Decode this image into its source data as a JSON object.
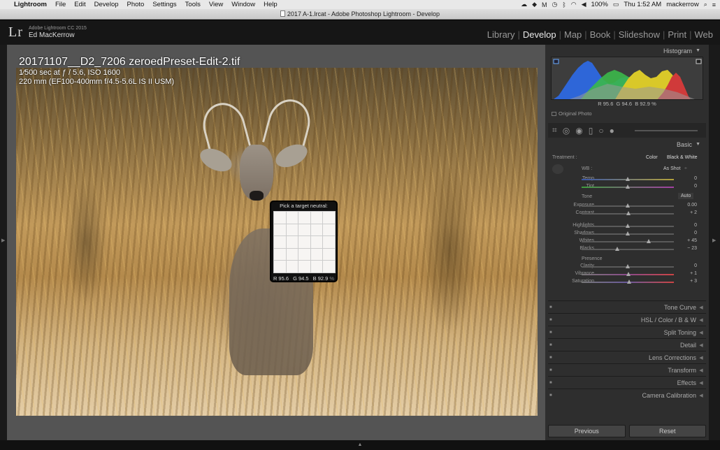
{
  "menubar": {
    "items": [
      "Lightroom",
      "File",
      "Edit",
      "Develop",
      "Photo",
      "Settings",
      "Tools",
      "View",
      "Window",
      "Help"
    ],
    "battery": "100%",
    "datetime": "Thu 1:52 AM",
    "user": "mackerrow"
  },
  "titlebar": {
    "title": "2017 A-1.lrcat - Adobe Photoshop Lightroom - Develop"
  },
  "identity": {
    "product": "Adobe Lightroom CC 2015",
    "name": "Ed MacKerrow",
    "logo": "Lr"
  },
  "modules": [
    "Library",
    "Develop",
    "Map",
    "Book",
    "Slideshow",
    "Print",
    "Web"
  ],
  "active_module": "Develop",
  "photo_info": {
    "filename": "20171107__D2_7206 zeroedPreset-Edit-2.tif",
    "exposure": "1⁄500 sec at ƒ / 5.6, ISO 1600",
    "lens": "220 mm (EF100-400mm f/4.5-5.6L IS II USM)"
  },
  "neutral_picker": {
    "title": "Pick a target neutral:",
    "r": "95.6",
    "g": "94.5",
    "b": "92.9",
    "unit": "%"
  },
  "histogram": {
    "label": "Histogram",
    "r": "95.6",
    "g": "94.6",
    "b": "92.9",
    "unit": "%",
    "original_photo": "Original Photo"
  },
  "basic": {
    "label": "Basic",
    "treatment_label": "Treatment :",
    "treatment_color": "Color",
    "treatment_bw": "Black & White",
    "wb_label": "WB :",
    "wb_value": "As Shot",
    "temp": {
      "label": "Temp",
      "value": "0",
      "pos": 0.5
    },
    "tint": {
      "label": "Tint",
      "value": "0",
      "pos": 0.5
    },
    "tone_label": "Tone",
    "auto": "Auto",
    "exposure": {
      "label": "Exposure",
      "value": "0.00",
      "pos": 0.5
    },
    "contrast": {
      "label": "Contrast",
      "value": "+ 2",
      "pos": 0.51
    },
    "highlights": {
      "label": "Highlights",
      "value": "0",
      "pos": 0.5
    },
    "shadows": {
      "label": "Shadows",
      "value": "0",
      "pos": 0.5
    },
    "whites": {
      "label": "Whites",
      "value": "+ 45",
      "pos": 0.725
    },
    "blacks": {
      "label": "Blacks",
      "value": "− 23",
      "pos": 0.385
    },
    "presence_label": "Presence",
    "clarity": {
      "label": "Clarity",
      "value": "0",
      "pos": 0.5
    },
    "vibrance": {
      "label": "Vibrance",
      "value": "+ 1",
      "pos": 0.505
    },
    "saturation": {
      "label": "Saturation",
      "value": "+ 3",
      "pos": 0.515
    }
  },
  "panels": [
    "Tone Curve",
    "HSL / Color / B & W",
    "Split Toning",
    "Detail",
    "Lens Corrections",
    "Transform",
    "Effects",
    "Camera Calibration"
  ],
  "buttons": {
    "previous": "Previous",
    "reset": "Reset"
  },
  "colors": {
    "active": "#e8e8e8",
    "panel": "#2e2e2e",
    "background": "#545454"
  }
}
